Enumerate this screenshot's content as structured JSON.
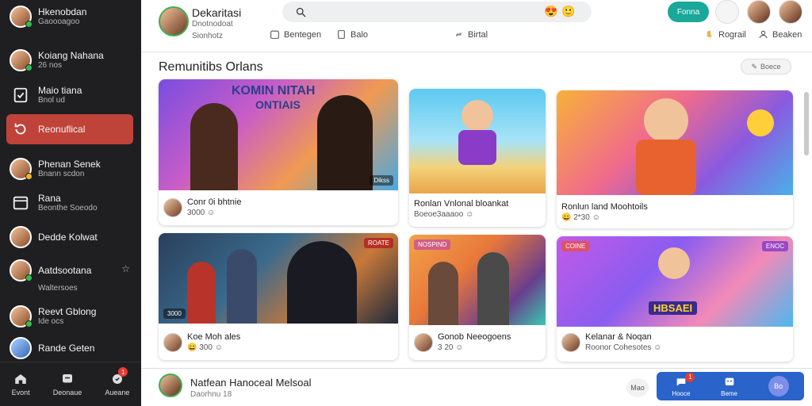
{
  "sidebar": {
    "items": [
      {
        "title": "Hkenobdan",
        "sub": "Gaoooagoo"
      },
      {
        "title": "Koiang Nahana",
        "sub": "26 nos"
      },
      {
        "title": "Maio tiana",
        "sub": "Bnol ud"
      },
      {
        "title": "Reonuflical",
        "sub": ""
      },
      {
        "title": "Phenan Senek",
        "sub": "Bnann scdon"
      },
      {
        "title": "Rana",
        "sub": "Beonthe Soeodo"
      },
      {
        "title": "Dedde Kolwat",
        "sub": ""
      },
      {
        "title": "Aatdsootana",
        "sub": "Waltersoes"
      },
      {
        "title": "Reevt Gblong",
        "sub": "Ide ocs"
      },
      {
        "title": "Rande Geten",
        "sub": ""
      }
    ],
    "bottom": [
      {
        "label": "Evont",
        "icon": "home-icon"
      },
      {
        "label": "Deonaue",
        "icon": "chat-icon"
      },
      {
        "label": "Aueane",
        "icon": "notifications-icon",
        "badge": "1"
      }
    ]
  },
  "header": {
    "name": "Dekaritasi",
    "sub1": "Dnotnodoat",
    "sub2": "Sionhotz",
    "search": {
      "placeholder": ""
    },
    "links": [
      "Bentegen",
      "Balo",
      "Birtal"
    ],
    "right_links": [
      "Rograil",
      "Beaken"
    ],
    "cta": "Fonna"
  },
  "main": {
    "title": "Remunitibs Orlans",
    "pill": "Boece",
    "cards": [
      {
        "banner": "KOMIN NITAH",
        "banner_sub": "ONTIAIS",
        "tag": "Dikss",
        "title": "Conr 0i bhtnie",
        "stat": "3000 ☺"
      },
      {
        "banner": "",
        "banner_sub": "",
        "tag": "",
        "title": "Ronlan Vnlonal bloankat",
        "stat": "Boeoe3aaaoo ☺"
      },
      {
        "banner": "",
        "banner_sub": "",
        "tag": "",
        "title": "Ronlun land Moohtoils",
        "stat": "😄 2*30 ☺"
      },
      {
        "banner": "",
        "banner_sub": "",
        "tag": "3000",
        "tag2": "ROATE",
        "title": "Koe Moh ales",
        "stat": "😄 300 ☺"
      },
      {
        "banner": "",
        "banner_sub": "",
        "tag": "NOSPIND",
        "title": "Gonob Neeogoens",
        "stat": "3 20 ☺"
      },
      {
        "banner": "HBSAEI",
        "banner_sub": "",
        "tag": "COINE",
        "tag2": "ENOC",
        "title": "Kelanar & Noqan",
        "stat": "Roonor Cohesotes ☺"
      }
    ]
  },
  "bottom": {
    "name": "Natfean Hanoceal Melsoal",
    "sub": "Daorhnu 18",
    "count": "Mao",
    "buttons": [
      {
        "label": "Hooce",
        "icon": "chat-bubble-icon",
        "badge": "1"
      },
      {
        "label": "Beme",
        "icon": "game-icon"
      }
    ],
    "circle": "Bo"
  },
  "colors": {
    "sidebar_bg": "#1f1f22",
    "active": "#c0433a",
    "accent": "#19a89a",
    "bottom_blue": "#2a63c9"
  }
}
